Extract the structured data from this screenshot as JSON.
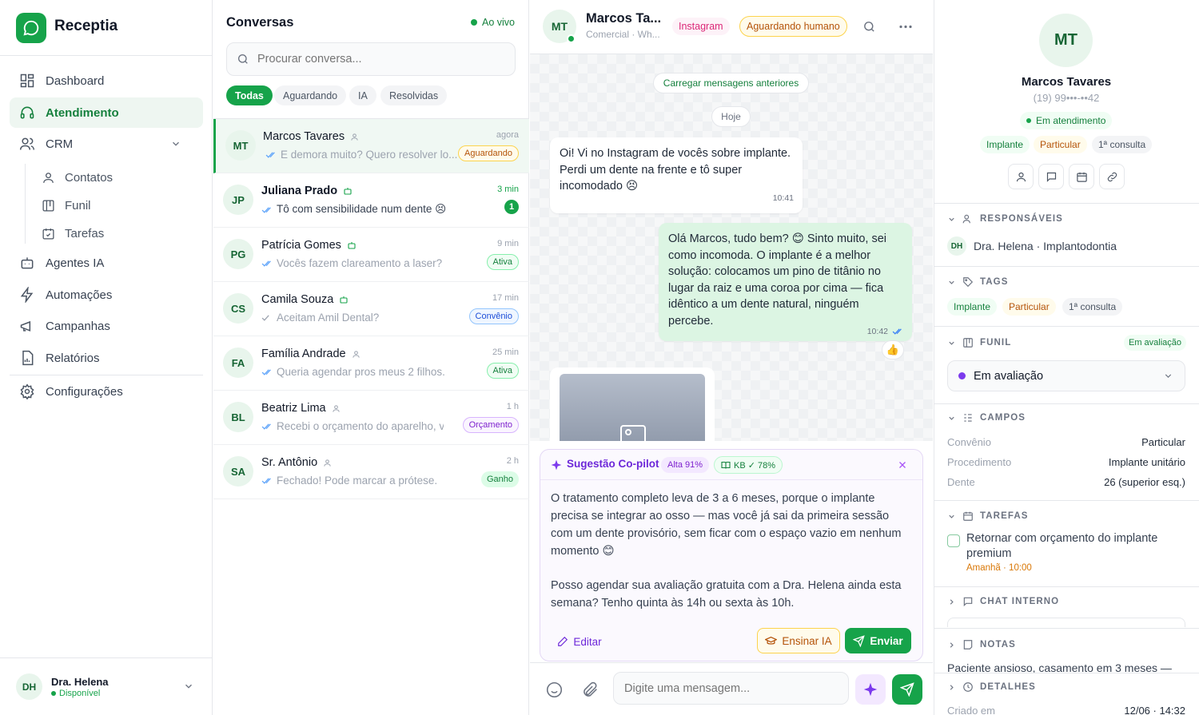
{
  "brand": {
    "name": "Receptia"
  },
  "nav": {
    "items": [
      {
        "label": "Dashboard",
        "icon": "grid-icon"
      },
      {
        "label": "Atendimento",
        "icon": "headset-icon"
      },
      {
        "label": "CRM",
        "icon": "users-icon"
      },
      {
        "label": "Agentes IA",
        "icon": "bot-icon"
      },
      {
        "label": "Automações",
        "icon": "bolt-icon"
      },
      {
        "label": "Campanhas",
        "icon": "megaphone-icon"
      },
      {
        "label": "Relatórios",
        "icon": "report-icon"
      },
      {
        "label": "Configurações",
        "icon": "gear-icon"
      }
    ],
    "crm_sub": [
      "Contatos",
      "Funil",
      "Tarefas"
    ]
  },
  "user": {
    "initials": "DH",
    "name": "Dra. Helena",
    "status": "Disponível"
  },
  "conversations": {
    "title": "Conversas",
    "live": "Ao vivo",
    "search_placeholder": "Procurar conversa...",
    "filters": [
      "Todas",
      "Aguardando",
      "IA",
      "Resolvidas"
    ],
    "items": [
      {
        "initials": "MT",
        "name": "Marcos Tavares",
        "preview": "E demora muito? Quero resolver lo...",
        "time": "agora",
        "badge": "Aguardando"
      },
      {
        "initials": "JP",
        "name": "Juliana Prado",
        "preview": "Tô com sensibilidade num dente 😣",
        "time": "3 min",
        "count": "1"
      },
      {
        "initials": "PG",
        "name": "Patrícia Gomes",
        "preview": "Vocês fazem clareamento a laser?",
        "time": "9 min",
        "badge": "Ativa"
      },
      {
        "initials": "CS",
        "name": "Camila Souza",
        "preview": "Aceitam Amil Dental?",
        "time": "17 min",
        "badge": "Convênio"
      },
      {
        "initials": "FA",
        "name": "Família Andrade",
        "preview": "Queria agendar pros meus 2 filhos.",
        "time": "25 min",
        "badge": "Ativa"
      },
      {
        "initials": "BL",
        "name": "Beatriz Lima",
        "preview": "Recebi o orçamento do aparelho, vo...",
        "time": "1 h",
        "badge": "Orçamento"
      },
      {
        "initials": "SA",
        "name": "Sr. Antônio",
        "preview": "Fechado! Pode marcar a prótese.",
        "time": "2 h",
        "badge": "Ganho"
      }
    ]
  },
  "chat": {
    "initials": "MT",
    "name": "Marcos Ta...",
    "subtitle": "Comercial · Wh...",
    "channel": "Instagram",
    "status": "Aguardando humano",
    "load_more": "Carregar mensagens anteriores",
    "day": "Hoje",
    "msg_in": {
      "text": "Oi! Vi no Instagram de vocês sobre implante. Perdi um dente na frente e tô super incomodado 😣",
      "time": "10:41"
    },
    "msg_out": {
      "text": "Olá Marcos, tudo bem? 😊 Sinto muito, sei como incomoda. O implante é a melhor solução: colocamos um pino de titânio no lugar da raiz e uma coroa por cima — fica idêntico a um dente natural, ninguém percebe.",
      "time": "10:42",
      "reaction": "👍"
    },
    "copilot": {
      "title": "Sugestão Co-pilot",
      "confidence": "Alta 91%",
      "kb": "KB ✓ 78%",
      "p1": "O tratamento completo leva de 3 a 6 meses, porque o implante precisa se integrar ao osso — mas você já sai da primeira sessão com um dente provisório, sem ficar com o espaço vazio em nenhum momento 😊",
      "p2": "Posso agendar sua avaliação gratuita com a Dra. Helena ainda esta semana? Tenho quinta às 14h ou sexta às 10h.",
      "edit": "Editar",
      "teach": "Ensinar IA",
      "send": "Enviar"
    },
    "composer_placeholder": "Digite uma mensagem..."
  },
  "contact": {
    "initials": "MT",
    "name": "Marcos Tavares",
    "phone": "(19) 99•••-••42",
    "status": "Em atendimento",
    "tags": [
      "Implante",
      "Particular",
      "1ª consulta"
    ],
    "sections": {
      "responsaveis": "RESPONSÁVEIS",
      "tags": "TAGS",
      "funil": "FUNIL",
      "campos": "CAMPOS",
      "tarefas": "TAREFAS",
      "chat_interno": "CHAT INTERNO",
      "notas": "NOTAS",
      "detalhes": "DETALHES"
    },
    "owner": {
      "initials": "DH",
      "name": "Dra. Helena · Implantodontia"
    },
    "funil_badge": "Em avaliação",
    "funil_stage": "Em avaliação",
    "fields": [
      {
        "k": "Convênio",
        "v": "Particular"
      },
      {
        "k": "Procedimento",
        "v": "Implante unitário"
      },
      {
        "k": "Dente",
        "v": "26 (superior esq.)"
      }
    ],
    "task": {
      "text": "Retornar com orçamento do implante premium",
      "due": "Amanhã · 10:00"
    },
    "note": "Paciente ansioso, casamento em 3 meses —",
    "details": {
      "k": "Criado em",
      "v": "12/06 · 14:32"
    }
  },
  "colors": {
    "accent": "#16a34a",
    "purple": "#7c3aed",
    "orange": "#b45309"
  }
}
